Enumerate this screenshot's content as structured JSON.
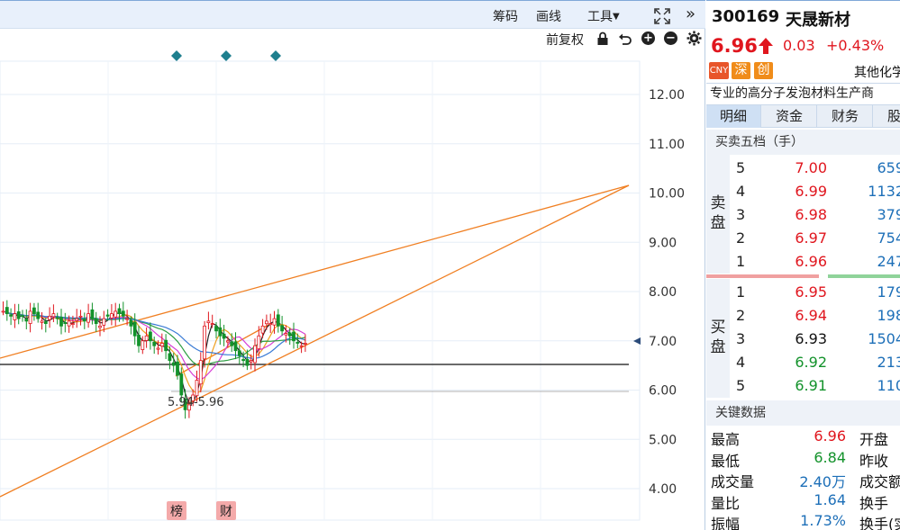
{
  "toolbar": {
    "chips_label": "筹码",
    "draw_label": "画线",
    "tools_label": "工具",
    "adjust_label": "前复权"
  },
  "chart": {
    "y_ticks": [
      "12.00",
      "11.00",
      "10.00",
      "9.00",
      "8.00",
      "7.00",
      "6.00",
      "5.00",
      "4.00"
    ],
    "low_annotation": "5.94-5.96",
    "event_markers": [
      "榜",
      "财"
    ],
    "colors": {
      "up": "#e0161e",
      "down": "#13922b",
      "trendline": "#f07f22",
      "grid": "#e6eef7"
    }
  },
  "stock": {
    "code": "300169",
    "name": "天晟新材",
    "price": "6.96",
    "change": "0.03",
    "change_pct": "+0.43%",
    "tags": [
      {
        "text": "CNY",
        "color": "#e8552a"
      },
      {
        "text": "深",
        "color": "#f08c1a"
      },
      {
        "text": "创",
        "color": "#f08c1a"
      }
    ],
    "industry": "其他化学",
    "description": "专业的高分子发泡材料生产商"
  },
  "tabs": [
    "明细",
    "资金",
    "财务",
    "股东"
  ],
  "orderbook": {
    "title": "买卖五档（手）",
    "sell_label": "卖盘",
    "buy_label": "买盘",
    "sell": [
      {
        "level": "5",
        "price": "7.00",
        "volume": "659"
      },
      {
        "level": "4",
        "price": "6.99",
        "volume": "1132"
      },
      {
        "level": "3",
        "price": "6.98",
        "volume": "379"
      },
      {
        "level": "2",
        "price": "6.97",
        "volume": "754"
      },
      {
        "level": "1",
        "price": "6.96",
        "volume": "247"
      }
    ],
    "buy": [
      {
        "level": "1",
        "price": "6.95",
        "volume": "179"
      },
      {
        "level": "2",
        "price": "6.94",
        "volume": "198"
      },
      {
        "level": "3",
        "price": "6.93",
        "volume": "1504"
      },
      {
        "level": "4",
        "price": "6.92",
        "volume": "213"
      },
      {
        "level": "5",
        "price": "6.91",
        "volume": "110"
      }
    ]
  },
  "key_data": {
    "title": "关键数据",
    "rows": [
      {
        "label": "最高",
        "value": "6.96",
        "right": "开盘"
      },
      {
        "label": "最低",
        "value": "6.84",
        "right": "昨收"
      },
      {
        "label": "成交量",
        "value": "2.40万",
        "right": "成交额"
      },
      {
        "label": "量比",
        "value": "1.64",
        "right": "换手"
      },
      {
        "label": "振幅",
        "value": "1.73%",
        "right": "换手(实)"
      }
    ]
  }
}
